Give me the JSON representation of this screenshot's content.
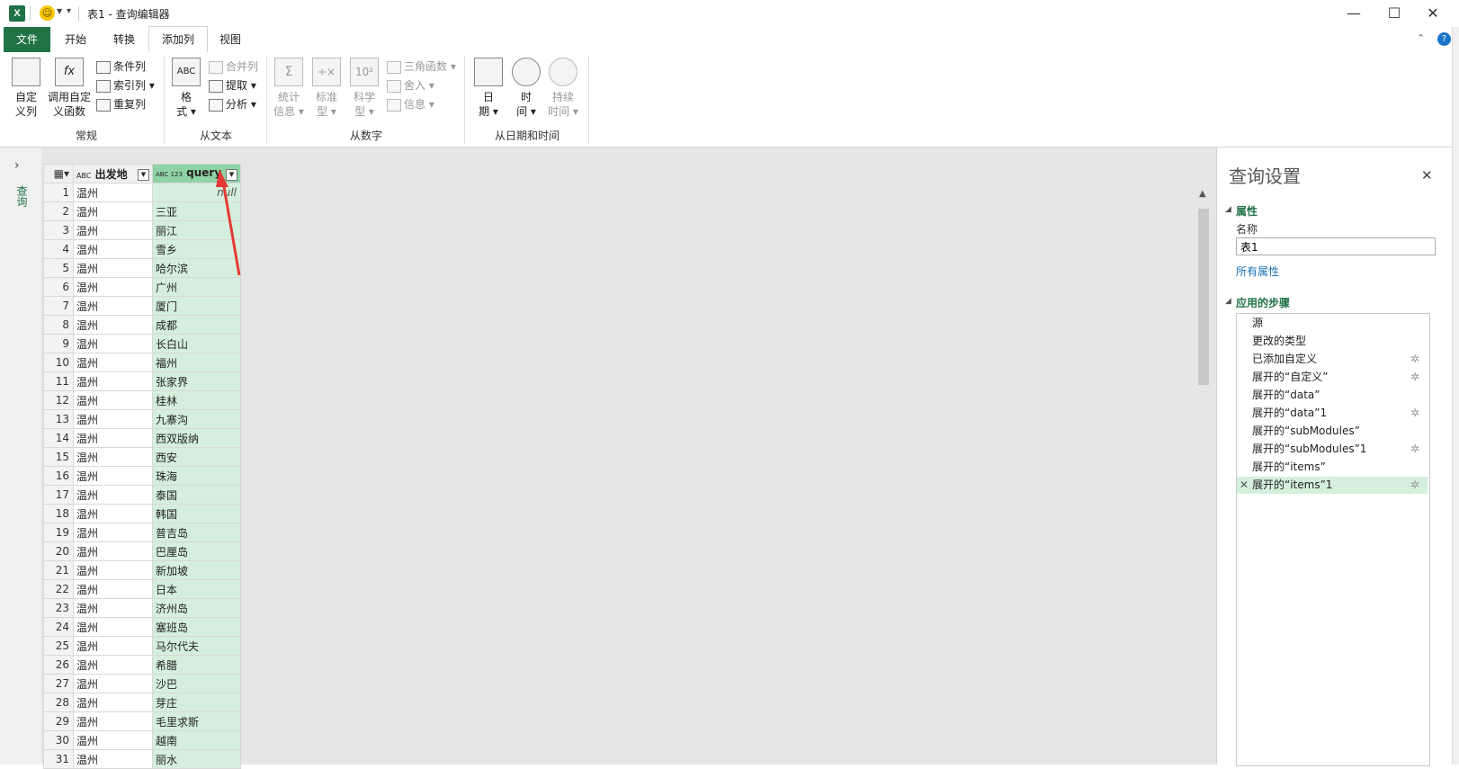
{
  "window": {
    "title": "表1 - 查询编辑器",
    "app_icon": "X",
    "minimize": "—",
    "maximize": "☐",
    "close": "✕"
  },
  "tabs": [
    "文件",
    "开始",
    "转换",
    "添加列",
    "视图"
  ],
  "ribbon": {
    "general": {
      "custom_column": [
        "自定",
        "义列"
      ],
      "invoke_custom_function": [
        "调用自定",
        "义函数"
      ],
      "conditional_column": "条件列",
      "index_column": "索引列",
      "duplicate_column": "重复列",
      "group_label": "常规"
    },
    "from_text": {
      "format": [
        "格",
        "式"
      ],
      "merge_columns": "合并列",
      "extract": "提取",
      "parse": "分析",
      "group_label": "从文本"
    },
    "from_number": {
      "statistics": [
        "统计",
        "信息"
      ],
      "standard": [
        "标准",
        "型"
      ],
      "scientific": [
        "科学",
        "型"
      ],
      "trigonometry": "三角函数",
      "rounding": "舍入",
      "information": "信息",
      "group_label": "从数字"
    },
    "from_datetime": {
      "date": [
        "日",
        "期"
      ],
      "time": [
        "时",
        "间"
      ],
      "duration": [
        "持续",
        "时间"
      ],
      "group_label": "从日期和时间"
    }
  },
  "left_pane": {
    "label": "查询"
  },
  "grid": {
    "columns": [
      {
        "type_icon": "ABC",
        "name": "出发地"
      },
      {
        "type_icon": "ABC 123",
        "name": "query"
      }
    ],
    "rows": [
      [
        "1",
        "温州",
        "null"
      ],
      [
        "2",
        "温州",
        "三亚"
      ],
      [
        "3",
        "温州",
        "丽江"
      ],
      [
        "4",
        "温州",
        "雪乡"
      ],
      [
        "5",
        "温州",
        "哈尔滨"
      ],
      [
        "6",
        "温州",
        "广州"
      ],
      [
        "7",
        "温州",
        "厦门"
      ],
      [
        "8",
        "温州",
        "成都"
      ],
      [
        "9",
        "温州",
        "长白山"
      ],
      [
        "10",
        "温州",
        "福州"
      ],
      [
        "11",
        "温州",
        "张家界"
      ],
      [
        "12",
        "温州",
        "桂林"
      ],
      [
        "13",
        "温州",
        "九寨沟"
      ],
      [
        "14",
        "温州",
        "西双版纳"
      ],
      [
        "15",
        "温州",
        "西安"
      ],
      [
        "16",
        "温州",
        "珠海"
      ],
      [
        "17",
        "温州",
        "泰国"
      ],
      [
        "18",
        "温州",
        "韩国"
      ],
      [
        "19",
        "温州",
        "普吉岛"
      ],
      [
        "20",
        "温州",
        "巴厘岛"
      ],
      [
        "21",
        "温州",
        "新加坡"
      ],
      [
        "22",
        "温州",
        "日本"
      ],
      [
        "23",
        "温州",
        "济州岛"
      ],
      [
        "24",
        "温州",
        "塞班岛"
      ],
      [
        "25",
        "温州",
        "马尔代夫"
      ],
      [
        "26",
        "温州",
        "希腊"
      ],
      [
        "27",
        "温州",
        "沙巴"
      ],
      [
        "28",
        "温州",
        "芽庄"
      ],
      [
        "29",
        "温州",
        "毛里求斯"
      ],
      [
        "30",
        "温州",
        "越南"
      ],
      [
        "31",
        "温州",
        "丽水"
      ]
    ]
  },
  "query_settings": {
    "title": "查询设置",
    "properties_header": "属性",
    "name_label": "名称",
    "name_value": "表1",
    "all_properties_link": "所有属性",
    "applied_steps_header": "应用的步骤",
    "steps": [
      {
        "label": "源",
        "gear": false
      },
      {
        "label": "更改的类型",
        "gear": false
      },
      {
        "label": "已添加自定义",
        "gear": true
      },
      {
        "label": "展开的“自定义”",
        "gear": true
      },
      {
        "label": "展开的“data”",
        "gear": false
      },
      {
        "label": "展开的“data”1",
        "gear": true
      },
      {
        "label": "展开的“subModules”",
        "gear": false
      },
      {
        "label": "展开的“subModules”1",
        "gear": true
      },
      {
        "label": "展开的“items”",
        "gear": false
      },
      {
        "label": "展开的“items”1",
        "gear": true,
        "selected": true
      }
    ]
  },
  "colors": {
    "accent": "#217346",
    "selected_column": "#d5efdd",
    "selected_header": "#8fd3a4",
    "annotation_arrow": "#e53935"
  }
}
